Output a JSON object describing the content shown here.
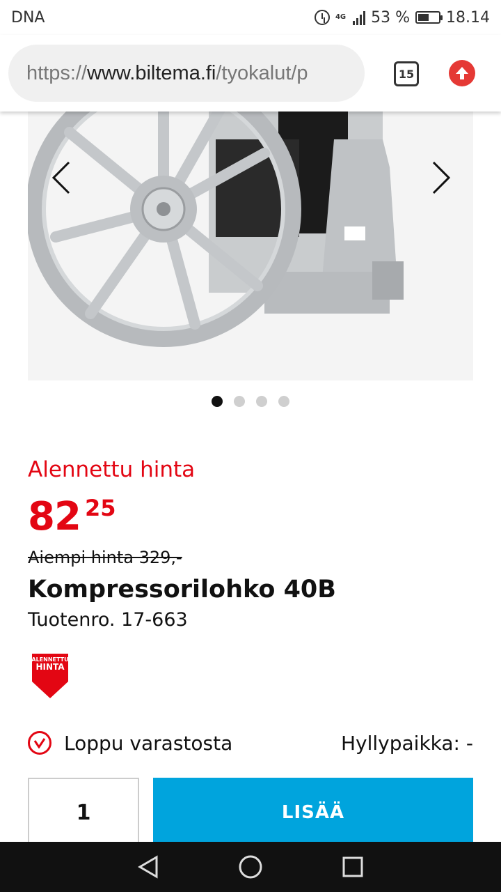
{
  "status_bar": {
    "carrier": "DNA",
    "network": "4G",
    "battery": "53 %",
    "time": "18.14"
  },
  "browser": {
    "url_prefix": "https://",
    "url_host": "www.biltema.fi",
    "url_path": "/tyokalut/p",
    "tab_count": "15"
  },
  "carousel": {
    "image_alt": "Kompressorilohko 40B",
    "active_index": 0,
    "total": 4
  },
  "product": {
    "discount_label": "Alennettu hinta",
    "price_whole": "82",
    "price_cents": "25",
    "old_price": "Aiempi hinta 329,-",
    "title": "Kompressorilohko 40B",
    "product_number": "Tuotenro. 17-663",
    "badge_line1": "ALENNETTU",
    "badge_line2": "HINTA"
  },
  "stock": {
    "status": "Loppu varastosta",
    "shelf": "Hyllypaikka: -"
  },
  "cart": {
    "quantity": "1",
    "add_label": "LISÄÄ"
  },
  "colors": {
    "accent_red": "#e30613",
    "button_blue": "#00a4dd"
  }
}
